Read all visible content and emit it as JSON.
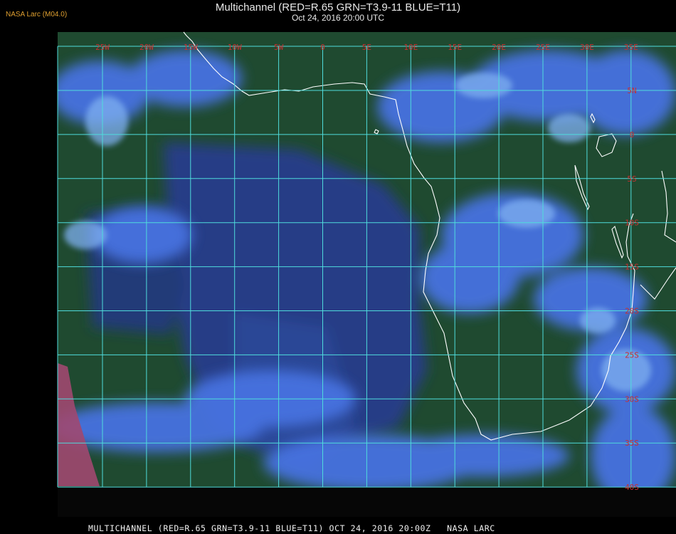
{
  "header": {
    "logo": "NASA Larc (M04.0)",
    "title": "Multichannel (RED=R.65 GRN=T3.9-11 BLUE=T11)",
    "subtitle": "Oct 24, 2016 20:00 UTC"
  },
  "footer": "MULTICHANNEL (RED=R.65 GRN=T3.9-11 BLUE=T11) OCT 24, 2016 20:00Z   NASA LARC",
  "grid": {
    "lon_labels": [
      "25W",
      "20W",
      "15W",
      "10W",
      "5W",
      "0",
      "5E",
      "10E",
      "15E",
      "20E",
      "25E",
      "30E",
      "35E"
    ],
    "lat_labels": [
      "5N",
      "0",
      "5S",
      "10S",
      "15S",
      "20S",
      "25S",
      "30S",
      "35S",
      "40S"
    ]
  },
  "colors": {
    "grid": "#4fdcdc",
    "labels": "#c83030",
    "coastline": "#ffffff",
    "ocean_clear": "#2a3a80",
    "green_area": "#1e4a2e",
    "cloud": "#4a78e6"
  }
}
